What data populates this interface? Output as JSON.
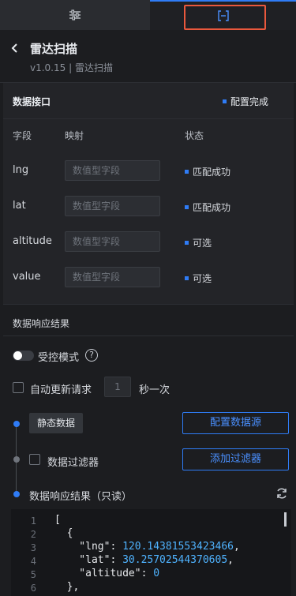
{
  "tabs": [
    {
      "icon": "sliders-icon"
    },
    {
      "icon": "data-bracket-icon",
      "active": true
    }
  ],
  "header": {
    "title": "雷达扫描",
    "subtitle": "v1.0.15 | 雷达扫描"
  },
  "data_interface": {
    "heading": "数据接口",
    "status": "配置完成",
    "columns": {
      "field": "字段",
      "mapping": "映射",
      "status": "状态"
    },
    "rows": [
      {
        "field": "lng",
        "placeholder": "数值型字段",
        "status": "匹配成功"
      },
      {
        "field": "lat",
        "placeholder": "数值型字段",
        "status": "匹配成功"
      },
      {
        "field": "altitude",
        "placeholder": "数值型字段",
        "status": "可选"
      },
      {
        "field": "value",
        "placeholder": "数值型字段",
        "status": "可选"
      }
    ]
  },
  "response": {
    "heading": "数据响应结果",
    "controlled_mode": "受控模式",
    "help_glyph": "?",
    "auto_update": "自动更新请求",
    "interval_value": "1",
    "interval_unit": "秒一次",
    "static_data": "静态数据",
    "configure_source": "配置数据源",
    "data_filter": "数据过滤器",
    "add_filter": "添加过滤器",
    "readonly_result": "数据响应结果（只读）"
  },
  "code_lines": [
    {
      "n": "1",
      "text": "["
    },
    {
      "n": "2",
      "text": "  {"
    },
    {
      "n": "3",
      "key": "    \"lng\": ",
      "num": "120.14381553423466",
      "tail": ","
    },
    {
      "n": "4",
      "key": "    \"lat\": ",
      "num": "30.25702544370605",
      "tail": ","
    },
    {
      "n": "5",
      "key": "    \"altitude\": ",
      "num": "0",
      "tail": ""
    },
    {
      "n": "6",
      "text": "  },"
    }
  ],
  "colors": {
    "accent": "#2f7cf6",
    "highlight_border": "#e9583d",
    "code_number": "#4fb3ff"
  }
}
